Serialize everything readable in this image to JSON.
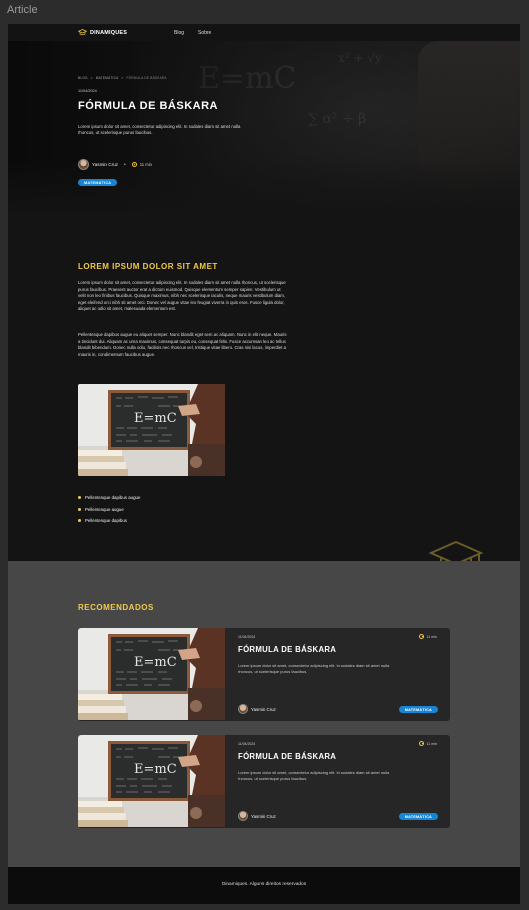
{
  "canvas_label": "Article",
  "nav": {
    "brand": "DINAMIQUES",
    "links": [
      "Blog",
      "Sobre"
    ]
  },
  "hero": {
    "breadcrumb": [
      "BLOG",
      "MATEMÁTICA",
      "FÓRMULA DE BÁSKARA"
    ],
    "breadcrumb_separator": ">",
    "date": "11/04/2024",
    "title": "FÓRMULA DE BÁSKARA",
    "description": "Lorem ipsum dolor sit amet, consectetur adipiscing elit. In sodales diam  sit amet nulla rhoncus, ut scelerisque purus faucibus.",
    "author": "Yasmin Cruz",
    "dot": "•",
    "read_time": "11 min",
    "category": "MATEMÁTICA"
  },
  "article": {
    "heading": "LOREM IPSUM DOLOR SIT AMET",
    "paragraph_1": "Lorem ipsum dolor sit amet, consectetur adipiscing elit. In sodales diam  sit amet nulla rhoncus, ut scelerisque purus faucibus. Praesent auctor  erat a dictum euismod. Quisque elementum semper sapien. Vestibulum ut  velit non leo finibus faucibus. Quisque maximus, nibh nec scelerisque  iaculis, neque mauris vestibulum diam, eget eleifend orci nibh sit amet  orci. Donec vel augue vitae leo feugiat viverra in quis eros. Fusce  ligula dolor, aliquet ac odio sit amet, malesuada elementum est.",
    "paragraph_2": "Pellentesque dapibus augue eu aliquet semper. Nunc blandit eget sem ac  aliquam. Nunc in elit neque. Mauris a tincidunt dui. Aliquam ac urna  maximus, consequat turpis eu, consequat felis. Fusce accumsan leo ac  tellus blandit bibendum. Donec nulla odio, facilisis nec rhoncus vel,  tristique vitae libero. Cras nisi lacus, imperdiet a mauris in,  condimentum faucibus augue.",
    "bullets": [
      "Pellentesque dapibus augue",
      "Pellentesque augue",
      "Pellentesque dapibus"
    ]
  },
  "recommended": {
    "heading": "RECOMENDADOS",
    "cards": [
      {
        "date": "11/04/2024",
        "read_time": "11 min",
        "title": "FÓRMULA DE BÁSKARA",
        "description": "Lorem ipsum dolor sit amet, consectetur adipiscing elit. In sodales diam  sit amet nulla rhoncus, ut scelerisque purus faucibus.",
        "author": "Yasmin Cruz",
        "category": "MATEMÁTICA"
      },
      {
        "date": "11/04/2024",
        "read_time": "11 min",
        "title": "FÓRMULA DE BÁSKARA",
        "description": "Lorem ipsum dolor sit amet, consectetur adipiscing elit. In sodales diam  sit amet nulla rhoncus, ut scelerisque purus faucibus.",
        "author": "Yasmin Cruz",
        "category": "MATEMÁTICA"
      }
    ]
  },
  "footer": {
    "text": "Dinamiques. Alguns direitos reservados"
  },
  "image_content": {
    "formula": "E=mC"
  },
  "colors": {
    "accent": "#f2c94c",
    "badge": "#1784d6",
    "page_bg": "#141414",
    "section_bg": "#474747",
    "card_bg": "#262626"
  }
}
